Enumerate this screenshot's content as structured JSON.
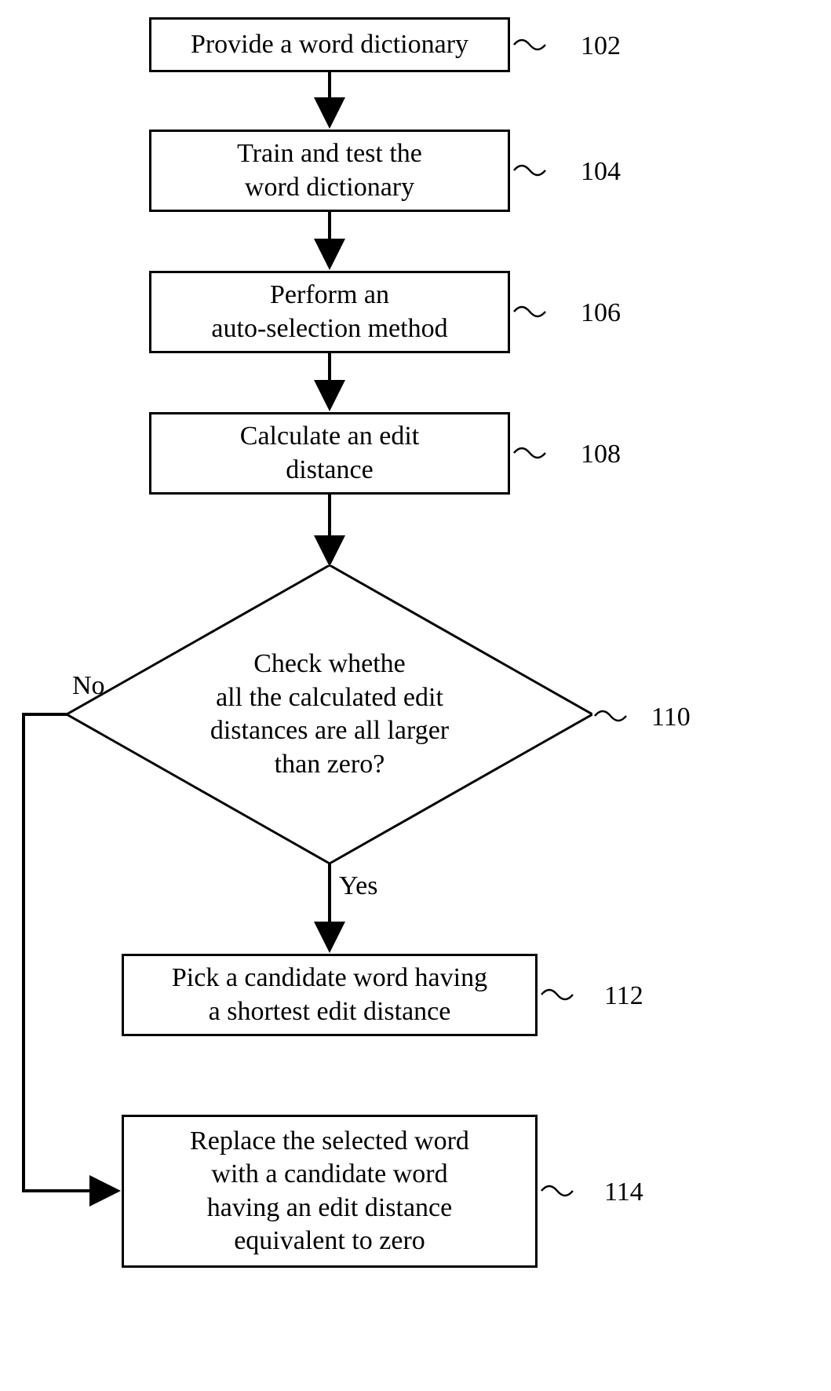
{
  "steps": {
    "s102": {
      "text": "Provide a word dictionary",
      "ref": "102"
    },
    "s104": {
      "text": "Train and test the\nword dictionary",
      "ref": "104"
    },
    "s106": {
      "text": "Perform an\nauto-selection method",
      "ref": "106"
    },
    "s108": {
      "text": "Calculate an edit\ndistance",
      "ref": "108"
    },
    "s110": {
      "text": "Check whethe\nall the calculated edit\ndistances are all larger\nthan zero?",
      "ref": "110"
    },
    "s112": {
      "text": "Pick a candidate word having\na shortest edit distance",
      "ref": "112"
    },
    "s114": {
      "text": "Replace the selected word\nwith a candidate word\nhaving an edit distance\nequivalent to zero",
      "ref": "114"
    }
  },
  "edges": {
    "no": "No",
    "yes": "Yes"
  }
}
